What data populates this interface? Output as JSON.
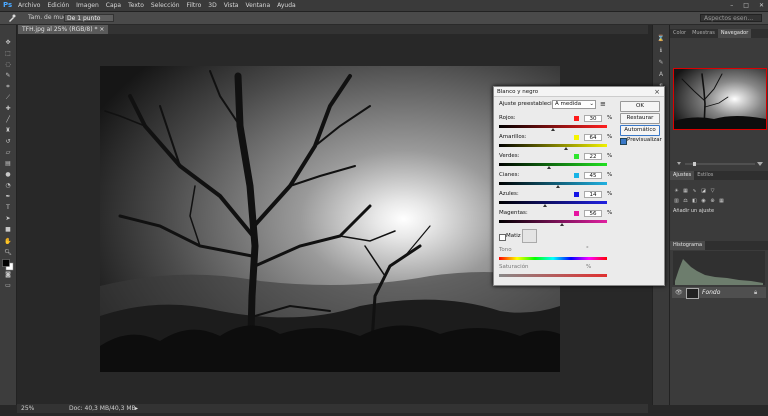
{
  "app": {
    "logo": "Ps"
  },
  "menu": [
    "Archivo",
    "Edición",
    "Imagen",
    "Capa",
    "Texto",
    "Selección",
    "Filtro",
    "3D",
    "Vista",
    "Ventana",
    "Ayuda"
  ],
  "window_controls": [
    "–",
    "□",
    "✕"
  ],
  "options_bar": {
    "sample_label": "Tam. de muestra:",
    "sample_value": "De 1 punto",
    "search_placeholder": "Aspectos esen..."
  },
  "document": {
    "tab_title": "TFH.jpg al 25% (RGB/8) * ×"
  },
  "status": {
    "zoom": "25%",
    "doc_info": "Doc: 40,3 MB/40,3 MB"
  },
  "panels": {
    "top_tabs": [
      "Color",
      "Muestras",
      "Navegador"
    ],
    "top_active": 2,
    "mid_tabs": [
      "Ajustes",
      "Estilos"
    ],
    "mid_active": 0,
    "adjust_header": "Añadir un ajuste",
    "histo_tab": "Histograma",
    "layer_name": "Fondo"
  },
  "dialog": {
    "title": "Blanco y negro",
    "preset_label": "Ajuste preestablecido:",
    "preset_value": "A medida",
    "ok": "OK",
    "reset": "Restaurar",
    "auto": "Automático",
    "preview": "Previsualizar",
    "tint": "Matiz",
    "hue": "Tono",
    "saturation": "Saturación",
    "degree": "°",
    "channels": [
      {
        "label": "Rojos:",
        "value": "30",
        "pct": "%",
        "color": "#ff1a1a",
        "pos": 0.5
      },
      {
        "label": "Amarillos:",
        "value": "64",
        "pct": "%",
        "color": "#f5f500",
        "pos": 0.62
      },
      {
        "label": "Verdes:",
        "value": "22",
        "pct": "%",
        "color": "#2ee62e",
        "pos": 0.46
      },
      {
        "label": "Cianes:",
        "value": "45",
        "pct": "%",
        "color": "#18b4e6",
        "pos": 0.55
      },
      {
        "label": "Azules:",
        "value": "14",
        "pct": "%",
        "color": "#1414e6",
        "pos": 0.43
      },
      {
        "label": "Magentas:",
        "value": "56",
        "pct": "%",
        "color": "#e614a0",
        "pos": 0.58
      }
    ]
  }
}
